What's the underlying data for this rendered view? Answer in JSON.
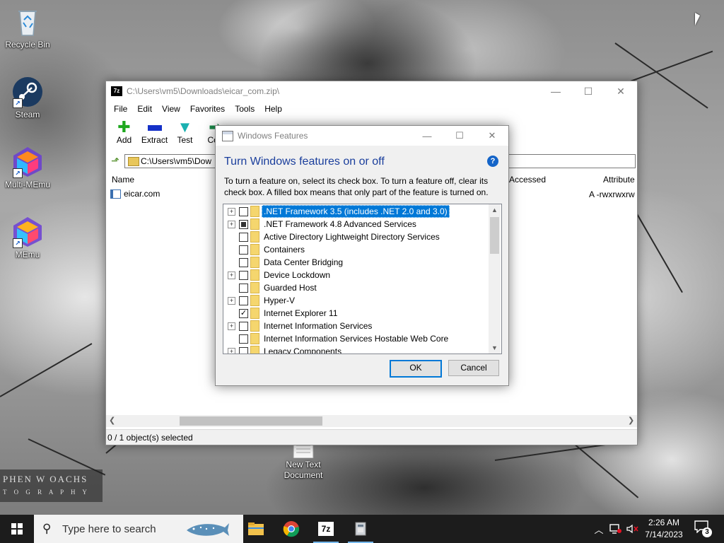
{
  "desktop": {
    "icons": [
      {
        "label": "Recycle Bin",
        "icon": "recycle-bin-icon"
      },
      {
        "label": "Steam",
        "icon": "steam-icon"
      },
      {
        "label": "Multi-MEmu",
        "icon": "multi-memu-icon"
      },
      {
        "label": "MEmu",
        "icon": "memu-icon"
      },
      {
        "label": "New Text Document",
        "icon": "text-document-icon"
      }
    ],
    "watermark": {
      "line1": "PHEN W OACHS",
      "line2": "T O G R A P H Y"
    }
  },
  "sevenzip": {
    "title": "C:\\Users\\vm5\\Downloads\\eicar_com.zip\\",
    "app_icon_text": "7z",
    "menu": [
      "File",
      "Edit",
      "View",
      "Favorites",
      "Tools",
      "Help"
    ],
    "toolbar": [
      {
        "label": "Add",
        "icon": "add-icon",
        "color": "#1fa81f"
      },
      {
        "label": "Extract",
        "icon": "extract-icon",
        "color": "#1531c8"
      },
      {
        "label": "Test",
        "icon": "test-icon",
        "color": "#1ab0b0"
      },
      {
        "label": "Cop",
        "icon": "copy-icon",
        "color": "#1c8a4a"
      }
    ],
    "address": "C:\\Users\\vm5\\Dow",
    "columns": {
      "name": "Name",
      "accessed": "Accessed",
      "attributes": "Attribute"
    },
    "files": [
      {
        "name": "eicar.com",
        "attributes": "A -rwxrwxrw"
      }
    ],
    "status": "0 / 1 object(s) selected"
  },
  "dialog": {
    "title": "Windows Features",
    "heading": "Turn Windows features on or off",
    "help": "?",
    "description": "To turn a feature on, select its check box. To turn a feature off, clear its check box. A filled box means that only part of the feature is turned on.",
    "features": [
      {
        "label": ".NET Framework 3.5 (includes .NET 2.0 and 3.0)",
        "expandable": true,
        "state": "unchecked",
        "selected": true
      },
      {
        "label": ".NET Framework 4.8 Advanced Services",
        "expandable": true,
        "state": "partial",
        "selected": false
      },
      {
        "label": "Active Directory Lightweight Directory Services",
        "expandable": false,
        "state": "unchecked",
        "selected": false
      },
      {
        "label": "Containers",
        "expandable": false,
        "state": "unchecked",
        "selected": false
      },
      {
        "label": "Data Center Bridging",
        "expandable": false,
        "state": "unchecked",
        "selected": false
      },
      {
        "label": "Device Lockdown",
        "expandable": true,
        "state": "unchecked",
        "selected": false
      },
      {
        "label": "Guarded Host",
        "expandable": false,
        "state": "unchecked",
        "selected": false
      },
      {
        "label": "Hyper-V",
        "expandable": true,
        "state": "unchecked",
        "selected": false
      },
      {
        "label": "Internet Explorer 11",
        "expandable": false,
        "state": "checked",
        "selected": false
      },
      {
        "label": "Internet Information Services",
        "expandable": true,
        "state": "unchecked",
        "selected": false
      },
      {
        "label": "Internet Information Services Hostable Web Core",
        "expandable": false,
        "state": "unchecked",
        "selected": false
      },
      {
        "label": "Legacy Components",
        "expandable": true,
        "state": "unchecked",
        "selected": false
      }
    ],
    "ok_label": "OK",
    "cancel_label": "Cancel"
  },
  "taskbar": {
    "search_placeholder": "Type here to search",
    "apps": [
      {
        "name": "File Explorer",
        "icon": "file-explorer-icon",
        "running": false
      },
      {
        "name": "Google Chrome",
        "icon": "chrome-icon",
        "running": false
      },
      {
        "name": "7-Zip",
        "icon": "7zip-icon",
        "running": true,
        "text": "7z"
      },
      {
        "name": "Windows Features",
        "icon": "windows-features-icon",
        "running": true
      }
    ],
    "time": "2:26 AM",
    "date": "7/14/2023",
    "notification_count": "3"
  },
  "colors": {
    "accent": "#0078d7",
    "heading": "#1a3e9c",
    "taskbar": "#1c1c1c"
  }
}
